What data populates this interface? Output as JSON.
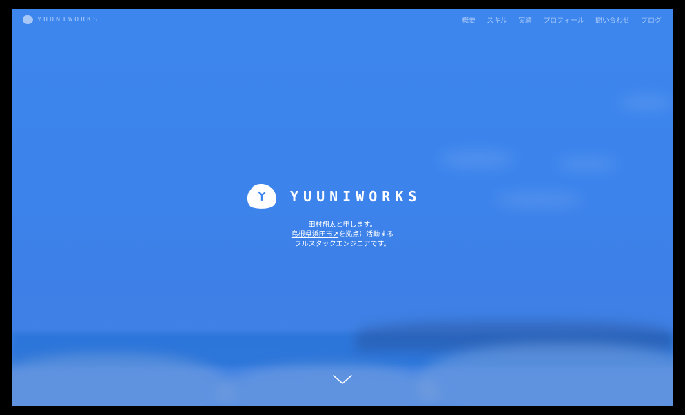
{
  "brand": {
    "name": "YUUNIWORKS"
  },
  "nav": {
    "items": [
      "概要",
      "スキル",
      "実績",
      "プロフィール",
      "問い合わせ",
      "ブログ"
    ]
  },
  "hero": {
    "logo_text": "YUUNIWORKS",
    "line1": "田村翔太と申します。",
    "line2_link": "島根県浜田市",
    "line2_link_icon": "↗",
    "line2_rest": "を拠点に活動する",
    "line3": "フルスタックエンジニアです。"
  },
  "icons": {
    "logo": "rounded-pebble-logo-icon",
    "external_link": "external-link-icon",
    "scroll": "chevron-down-icon"
  },
  "colors": {
    "background": "#3d86ee",
    "text": "#ffffff"
  }
}
